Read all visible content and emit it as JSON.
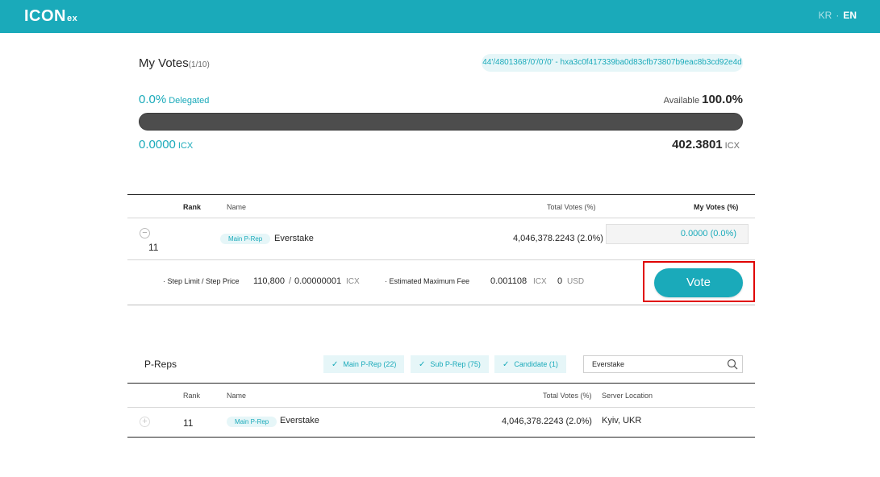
{
  "header": {
    "logo_main": "ICON",
    "logo_sub": "ex",
    "lang_kr": "KR",
    "lang_sep": "·",
    "lang_en": "EN"
  },
  "my_votes": {
    "title": "My Votes",
    "count": "(1/10)",
    "address": "44'/4801368'/0'/0'/0' - hxa3c0f417339ba0d83cfb73807b9eac8b3cd92e4d",
    "delegated_pct": "0.0%",
    "delegated_label": "Delegated",
    "available_label": "Available",
    "available_pct": "100.0%",
    "delegated_fraction": 0.0,
    "delegated_icx": "0.0000",
    "available_icx": "402.3801",
    "unit": "ICX"
  },
  "votes_table": {
    "headers": {
      "rank": "Rank",
      "name": "Name",
      "total": "Total Votes (%)",
      "my": "My Votes (%)"
    },
    "rows": [
      {
        "rank": "11",
        "badge": "Main P-Rep",
        "name": "Everstake",
        "total": "4,046,378.2243 (2.0%)",
        "my": "0.0000 (0.0%)"
      }
    ]
  },
  "fee": {
    "step_label": "· Step Limit / Step Price",
    "step_limit": "110,800",
    "slash": "/",
    "step_price": "0.00000001",
    "step_unit": "ICX",
    "est_label": "· Estimated Maximum Fee",
    "est_fee": "0.001108",
    "est_unit": "ICX",
    "usd_value": "0",
    "usd_unit": "USD",
    "vote_button": "Vote"
  },
  "preps": {
    "title": "P-Reps",
    "filters": [
      {
        "label": "Main P-Rep (22)"
      },
      {
        "label": "Sub P-Rep (75)"
      },
      {
        "label": "Candidate (1)"
      }
    ],
    "search_value": "Everstake",
    "headers": {
      "rank": "Rank",
      "name": "Name",
      "total": "Total Votes (%)",
      "location": "Server Location"
    },
    "rows": [
      {
        "rank": "11",
        "badge": "Main P-Rep",
        "name": "Everstake",
        "total": "4,046,378.2243 (2.0%)",
        "location": "Kyiv, UKR"
      }
    ]
  }
}
